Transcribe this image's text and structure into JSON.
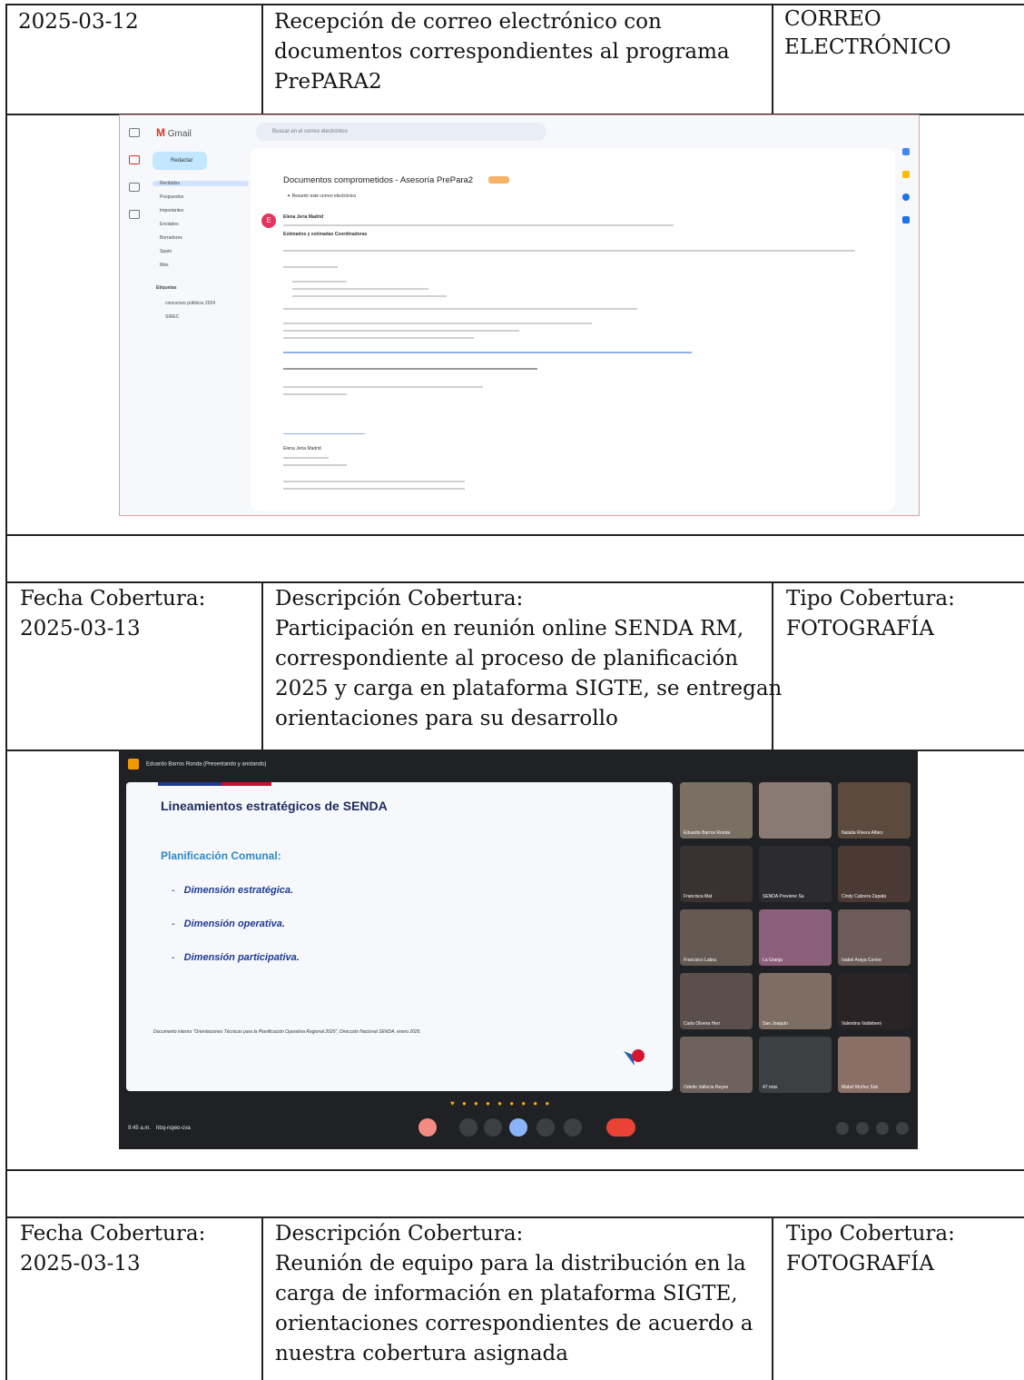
{
  "row1": {
    "date": "2025-03-12",
    "description_lines": [
      "Recepción de correo electrónico con",
      "documentos correspondientes al programa",
      "PrePARA2"
    ],
    "type_lines": [
      "CORREO",
      "ELECTRÓNICO"
    ]
  },
  "gmail": {
    "app_name": "Gmail",
    "compose": "Redactar",
    "nav": [
      "Recibidos",
      "Pospuestos",
      "Importantes",
      "Enviados",
      "Borradores",
      "Spam",
      "Más"
    ],
    "labels_title": "Etiquetas",
    "labels": [
      "concursos públicos 2024",
      "SIREC"
    ],
    "search_placeholder": "Buscar en el correo electrónico",
    "subject": "Documentos comprometidos - Asesoría PrePara2",
    "summary": "Resumir este correo electrónico",
    "from": "Elena Jeria Madrid",
    "greeting": "Estimados y estimadas Coordinadoras",
    "signature_name": "Elena Jeria Madrid"
  },
  "row2": {
    "date_label": "Fecha Cobertura:",
    "date": "2025-03-13",
    "desc_label": "Descripción Cobertura:",
    "description_lines": [
      "Participación en reunión online SENDA RM,",
      "correspondiente al proceso de planificación",
      "2025 y carga en plataforma SIGTE, se entregan",
      "orientaciones para su desarrollo"
    ],
    "type_label": "Tipo Cobertura:",
    "type": "FOTOGRAFÍA"
  },
  "meet": {
    "presenter": "Eduardo Barros Ronda (Presentando y anotando)",
    "slide_title": "Lineamientos estratégicos de SENDA",
    "slide_subtitle": "Planificación Comunal:",
    "slide_items": [
      "Dimensión estratégica.",
      "Dimensión operativa.",
      "Dimensión participativa."
    ],
    "slide_footer": "Documento interno \"Orientaciones Técnicas para la Planificación Operativa Regional 2025\", Dirección Nacional SENDA, enero 2025.",
    "participants": [
      "Eduardo Barros Ronda",
      "",
      "Natalia Rivera Alfaro",
      "Francisca Mat",
      "SENDA Previene Sa",
      "Cindy Cabrera Zapata",
      "Francisco Labra",
      "La Granja",
      "Isabel Araya Contre",
      "Carla Olivera Herr",
      "San Joaquín",
      "Valentina Valdebeni",
      "Odette Vallecia Reyes",
      "47 más",
      "Mabel Muñoz Sob"
    ],
    "time": "9:45 a.m.",
    "meeting_code": "hbq-nqwo-cva"
  },
  "row3": {
    "date_label": "Fecha Cobertura:",
    "date": "2025-03-13",
    "desc_label": "Descripción Cobertura:",
    "description_lines": [
      "Reunión de equipo para la distribución en la",
      "carga de información en plataforma SIGTE,",
      "orientaciones correspondientes de acuerdo a",
      "nuestra cobertura asignada"
    ],
    "type_label": "Tipo Cobertura:",
    "type": "FOTOGRAFÍA"
  }
}
